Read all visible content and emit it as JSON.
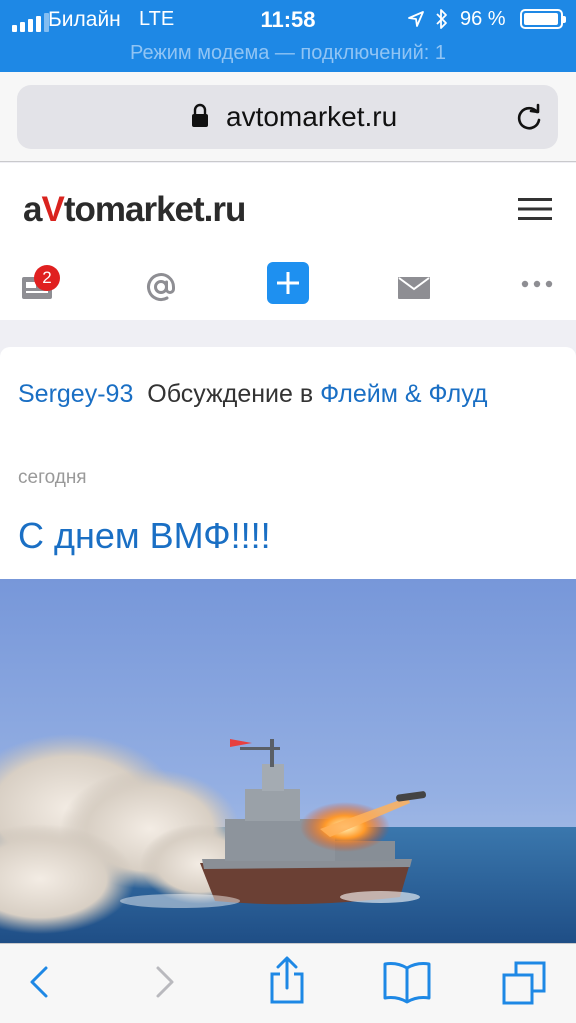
{
  "status_bar": {
    "carrier": "Билайн",
    "network": "LTE",
    "time": "11:58",
    "battery": "96 %",
    "battery_level": 0.96
  },
  "hotspot_banner": "Режим модема — подключений: 1",
  "browser": {
    "url": "avtomarket.ru"
  },
  "site": {
    "logo_a": "a",
    "logo_v": "V",
    "logo_rest": "tomarket.ru",
    "notifications_count": "2"
  },
  "post": {
    "author": "Sergey-93",
    "action": "Обсуждение в",
    "forum": "Флейм & Флуд",
    "date": "сегодня",
    "title": "С днем ВМФ!!!!"
  },
  "colors": {
    "status_bar": "#1e88e5",
    "link": "#1a6fc4",
    "logo_accent": "#d9231e",
    "badge": "#e02020",
    "add_button": "#1e90f0",
    "toolbar_icon": "#1e88e5"
  }
}
